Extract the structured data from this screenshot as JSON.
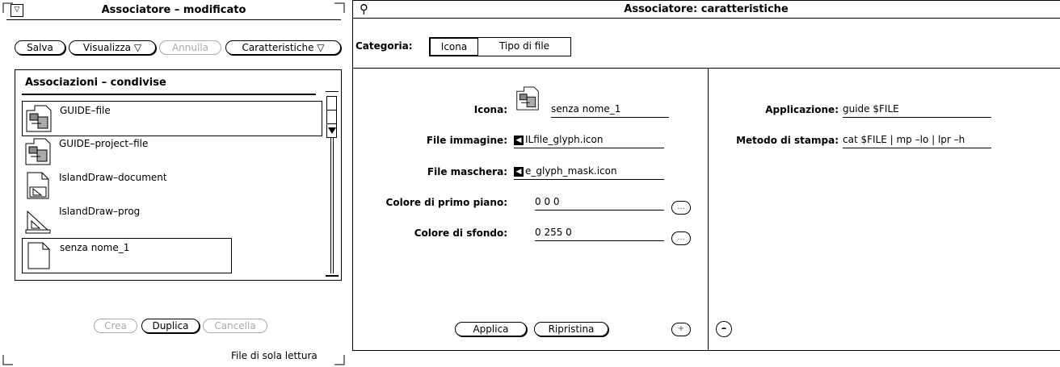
{
  "left": {
    "title": "Associatore – modificato",
    "menu_glyph": "▽",
    "buttons": {
      "salva": "Salva",
      "visualizza": "Visualizza ▽",
      "annulla": "Annulla",
      "caratteristiche": "Caratteristiche ▽"
    },
    "list_title": "Associazioni – condivise",
    "items": [
      "GUIDE–file",
      "GUIDE–project–file",
      "IslandDraw–document",
      "IslandDraw–prog",
      "senza nome_1"
    ],
    "bottom_buttons": {
      "crea": "Crea",
      "duplica": "Duplica",
      "cancella": "Cancella"
    },
    "footer": "File di sola lettura"
  },
  "right": {
    "title": "Associatore: caratteristiche",
    "pin_glyph": "⚲",
    "category_label": "Categoria:",
    "tabs": [
      "Icona",
      "Tipo di file"
    ],
    "icon_label": "Icona:",
    "icon_name": "senza nome_1",
    "image_file_label": "File immagine:",
    "image_file_value": "ILfile_glyph.icon",
    "mask_file_label": "File maschera:",
    "mask_file_value": "e_glyph_mask.icon",
    "fg_label": "Colore di primo piano:",
    "fg_value": "0 0 0",
    "bg_label": "Colore di sfondo:",
    "bg_value": "0 255 0",
    "ellipsis": "...",
    "apply": "Applica",
    "reset": "Ripristina",
    "plus": "+",
    "minus": "–",
    "app_label": "Applicazione:",
    "app_value": "guide $FILE",
    "print_label": "Metodo di stampa:",
    "print_value": "cat $FILE | mp –lo | lpr –h"
  }
}
